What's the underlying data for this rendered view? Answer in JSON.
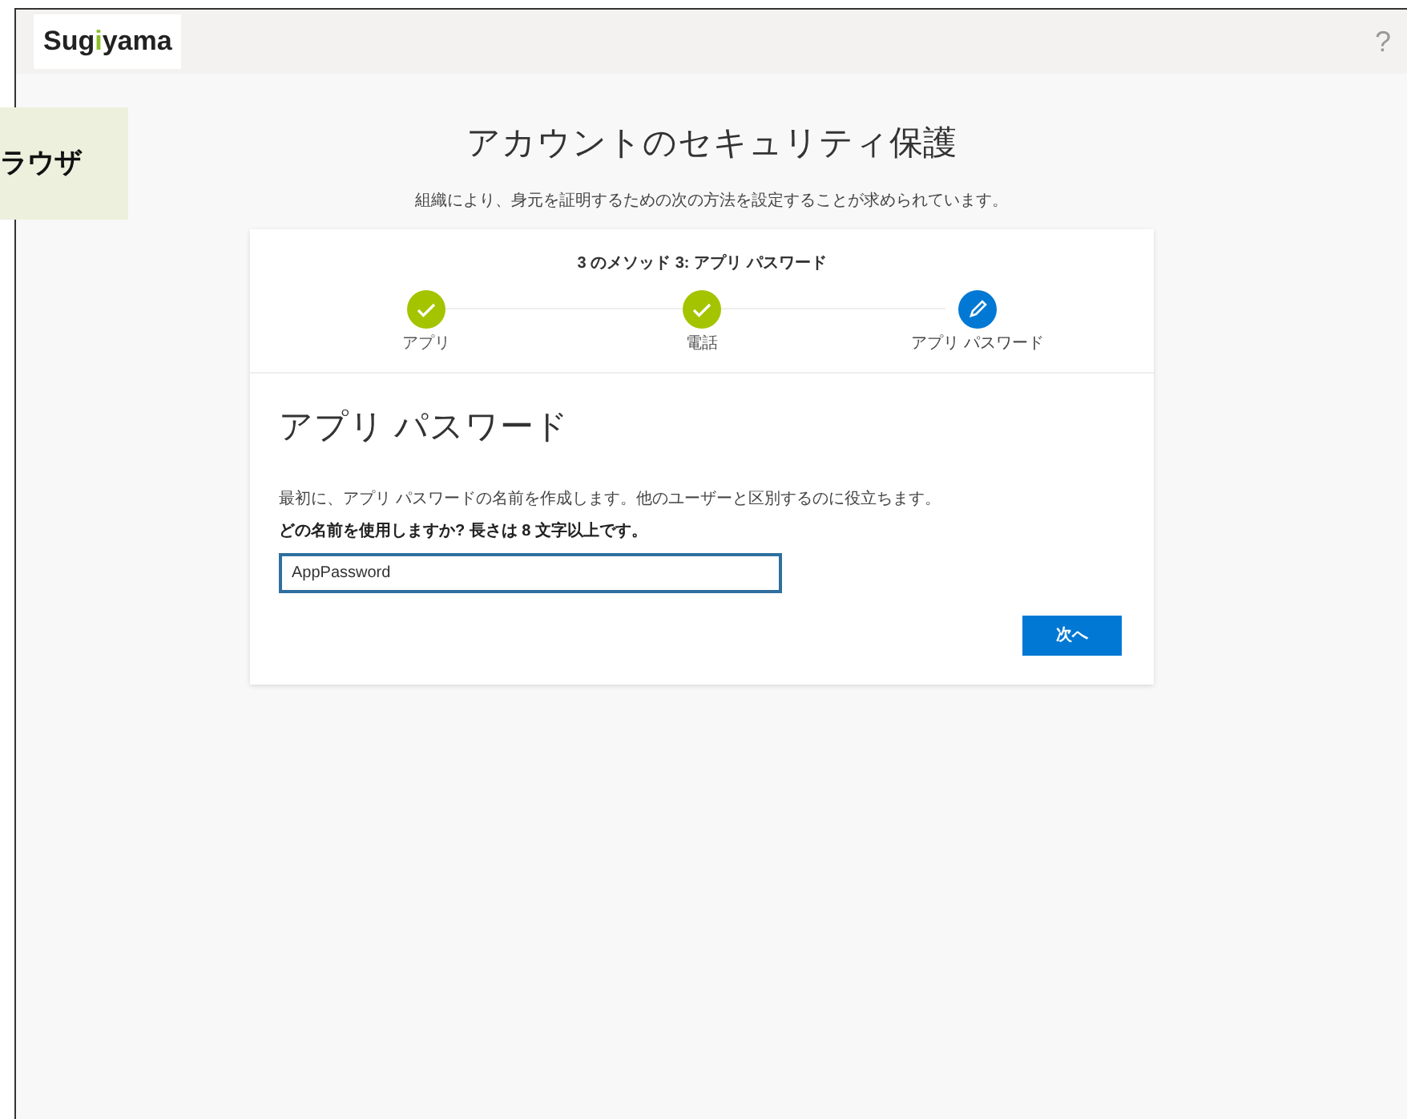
{
  "header": {
    "logo": [
      {
        "text": "Sug"
      },
      {
        "text": "i",
        "color": "#8cbf26"
      },
      {
        "text": "yama"
      }
    ],
    "help": "?"
  },
  "callout": "ラウザ",
  "title": "アカウントのセキュリティ保護",
  "subtitle": "組織により、身元を証明するための次の方法を設定することが求められています。",
  "wizard": {
    "progress": "3 のメソッド 3: アプリ パスワード",
    "steps": [
      {
        "label": "アプリ",
        "kind": "done"
      },
      {
        "label": "電話",
        "kind": "done"
      },
      {
        "label": "アプリ パスワード",
        "kind": "current"
      }
    ],
    "heading": "アプリ パスワード",
    "description": "最初に、アプリ パスワードの名前を作成します。他のユーザーと区別するのに役立ちます。",
    "question": "どの名前を使用しますか? 長さは 8 文字以上です。",
    "name_field": {
      "value": "AppPassword"
    },
    "next_button": "次へ"
  }
}
